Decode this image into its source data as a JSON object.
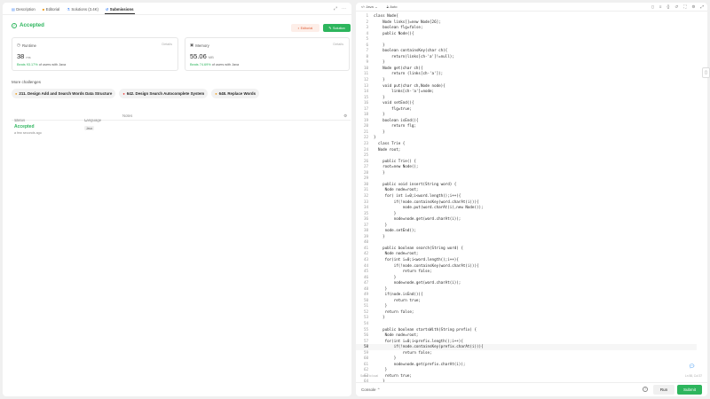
{
  "tabs": [
    {
      "label": "Description",
      "icon": "description-icon"
    },
    {
      "label": "Editorial",
      "icon": "editorial-icon"
    },
    {
      "label": "Solutions (3.4K)",
      "icon": "solutions-icon"
    },
    {
      "label": "Submissions",
      "icon": "submissions-icon"
    }
  ],
  "result": {
    "status": "Accepted",
    "editorial_label": "Editorial",
    "solution_label": "Solution"
  },
  "runtime": {
    "label": "Runtime",
    "details": "Details",
    "value": "38",
    "unit": "ms",
    "beats_pct": "Beats 93.17%",
    "beats_suffix": "of users with Java"
  },
  "memory": {
    "label": "Memory",
    "details": "Details",
    "value": "55.06",
    "unit": "MB",
    "beats_pct": "Beats 74.69%",
    "beats_suffix": "of users with Java"
  },
  "more_challenges": {
    "title": "More challenges",
    "items": [
      {
        "label": "211. Design Add and Search Words Data Structure",
        "color": "#f0a020"
      },
      {
        "label": "642. Design Search Autocomplete System",
        "color": "#ef4743"
      },
      {
        "label": "648. Replace Words",
        "color": "#f0a020"
      }
    ]
  },
  "submissions_table": {
    "headers": {
      "status": "Status",
      "language": "Language",
      "notes": "Notes"
    },
    "row": {
      "status": "Accepted",
      "time": "a few seconds ago",
      "language": "Java"
    }
  },
  "editor": {
    "language": "Java",
    "mode": "Auto",
    "saved_text": "Saved to local",
    "cursor_text": "Ln 58, Col 37",
    "lines": [
      "class Node{",
      "    Node links[]=new Node[26];",
      "    boolean flg=false;",
      "    public Node(){",
      "",
      "    }",
      "    boolean containsKey(char ch){",
      "        return(links[ch-'a']!=null);",
      "    }",
      "    Node get(char ch){",
      "        return (links[ch-'a']);",
      "    }",
      "    void put(char ch,Node node){",
      "        links[ch-'a']=node;",
      "    }",
      "    void setEnd(){",
      "        flg=true;",
      "    }",
      "    boolean isEnd(){",
      "        return flg;",
      "    }",
      "}",
      "  class Trie {",
      "  Node root;",
      "",
      "    public Trie() {",
      "    root=new Node();",
      "    }",
      "",
      "    public void insert(String word) {",
      "     Node node=root;",
      "     for( int i=0;i<word.length();i++){",
      "         if(!node.containsKey(word.charAt(i))){",
      "             node.put(word.charAt(i),new Node());",
      "         }",
      "         node=node.get(word.charAt(i));",
      "     }",
      "     node.setEnd();",
      "    }",
      "",
      "    public boolean search(String word) {",
      "     Node node=root;",
      "     for(int i=0;i<word.length();i++){",
      "         if(!node.containsKey(word.charAt(i))){",
      "             return false;",
      "         }",
      "         node=node.get(word.charAt(i));",
      "     }",
      "     if(node.isEnd()){",
      "         return true;",
      "     }",
      "     return false;",
      "    }",
      "",
      "    public boolean startsWith(String prefix) {",
      "     Node node=root;",
      "     for(int i=0;i<prefix.length();i++){",
      "         if(!node.containsKey(prefix.charAt(i))){",
      "             return false;",
      "         }",
      "         node=node.get(prefix.charAt(i));",
      "     }",
      "     return true;",
      "    }"
    ]
  },
  "console": {
    "label": "Console",
    "run_label": "Run",
    "submit_label": "Submit"
  },
  "colors": {
    "accent_green": "#2db55d",
    "editorial_orange": "#e0603a"
  }
}
